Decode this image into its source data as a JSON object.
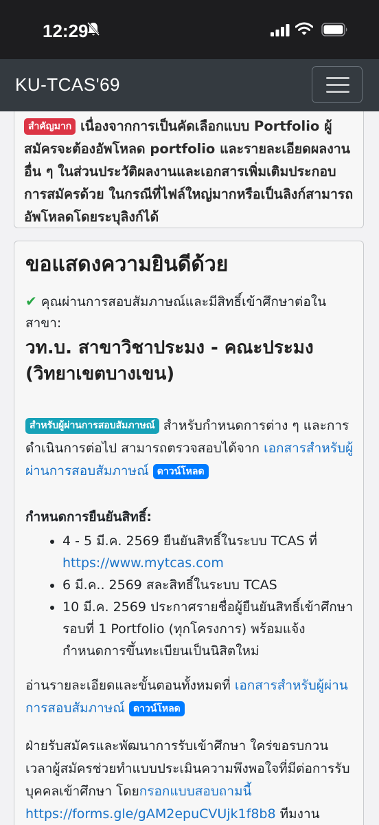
{
  "status_bar": {
    "time": "12:29"
  },
  "navbar": {
    "brand": "KU-TCAS'69"
  },
  "notice": {
    "badge": "สำคัญมาก",
    "text": "เนื่องจากการเป็นคัดเลือกแบบ Portfolio ผู้สมัครจะต้องอัพโหลด portfolio และรายละเอียดผลงานอื่น ๆ ในส่วนประวัติผลงานและเอกสารเพิ่มเติมประกอบการสมัครด้วย ในกรณีที่ไฟล์ใหญ่มากหรือเป็นลิงก์สามารถอัพโหลดโดยระบุลิงก์ได้"
  },
  "result": {
    "heading": "ขอแสดงความยินดีด้วย",
    "passed_text": "คุณผ่านการสอบสัมภาษณ์และมีสิทธิ์เข้าศึกษาต่อในสาขา:",
    "program": "วท.บ. สาขาวิชาประมง - คณะประมง (วิทยาเขตบางเขน)",
    "info_badge": "สำหรับผู้ผ่านการสอบสัมภาษณ์",
    "info_text": "สำหรับกำหนดการต่าง ๆ และการดำเนินการต่อไป สามารถตรวจสอบได้จาก",
    "doc_link": "เอกสารสำหรับผู้ผ่านการสอบสัมภาษณ์",
    "download_badge": "ดาวน์โหลด",
    "confirm_title": "กำหนดการยืนยันสิทธิ์:",
    "deadlines": [
      {
        "text": "4 - 5 มี.ค. 2569 ยืนยันสิทธิ์ในระบบ TCAS ที่",
        "link": "https://www.mytcas.com"
      },
      {
        "text": "6 มี.ค.. 2569 สละสิทธิ์ในระบบ TCAS",
        "link": ""
      },
      {
        "text": "10 มี.ค. 2569 ประกาศรายชื่อผู้ยืนยันสิทธิ์เข้าศึกษา รอบที่ 1 Portfolio (ทุกโครงการ) พร้อมแจ้งกำหนดการขึ้นทะเบียนเป็นนิสิตใหม่",
        "link": ""
      }
    ],
    "details_text": "อ่านรายละเอียดและขั้นตอนทั้งหมดที่",
    "details_link": "เอกสารสำหรับผู้ผ่านการสอบสัมภาษณ์",
    "details_badge": "ดาวน์โหลด",
    "survey_text": "ฝ่ายรับสมัครและพัฒนาการรับเข้าศึกษา ใคร่ขอรบกวนเวลาผู้สมัครช่วยทำแบบประเมินความพึงพอใจที่มีต่อการรับบุคคลเข้าศึกษา โดย",
    "survey_link": "กรอกแบบสอบถามนี้",
    "survey_url": "https://forms.gle/gAM2epuCVUjk1f8b8",
    "survey_tail": "ทีมงาน"
  }
}
